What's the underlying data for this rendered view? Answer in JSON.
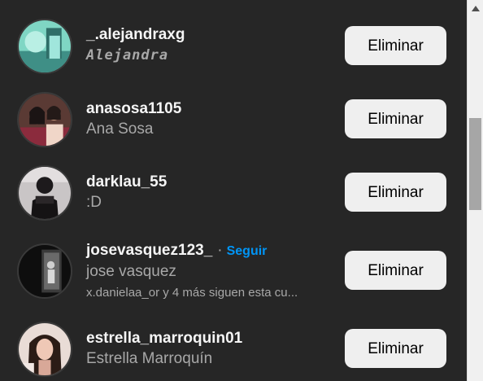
{
  "list": {
    "items": [
      {
        "username": "_.alejandraxg",
        "fullname": "Alejandra",
        "action": "Eliminar",
        "avatar": "avatar-teal-photo"
      },
      {
        "username": "anasosa1105",
        "fullname": "Ana Sosa",
        "action": "Eliminar",
        "avatar": "avatar-group-photo"
      },
      {
        "username": "darklau_55",
        "fullname": ":D",
        "action": "Eliminar",
        "avatar": "avatar-masked-person-photo"
      },
      {
        "username": "josevasquez123_",
        "separator": "·",
        "follow_label": "Seguir",
        "fullname": "jose vasquez",
        "mutual": "x.danielaa_or y 4 más siguen esta cu...",
        "action": "Eliminar",
        "avatar": "avatar-dark-mirror-photo"
      },
      {
        "username": "estrella_marroquin01",
        "fullname": "Estrella Marroquín",
        "action": "Eliminar",
        "avatar": "avatar-selfie-photo"
      }
    ]
  },
  "scrollbar": {
    "up_icon": "triangle-up-icon"
  },
  "colors": {
    "background": "#262626",
    "button_bg": "#efefef",
    "link_blue": "#0095f6",
    "secondary_text": "#a8a8a8"
  }
}
